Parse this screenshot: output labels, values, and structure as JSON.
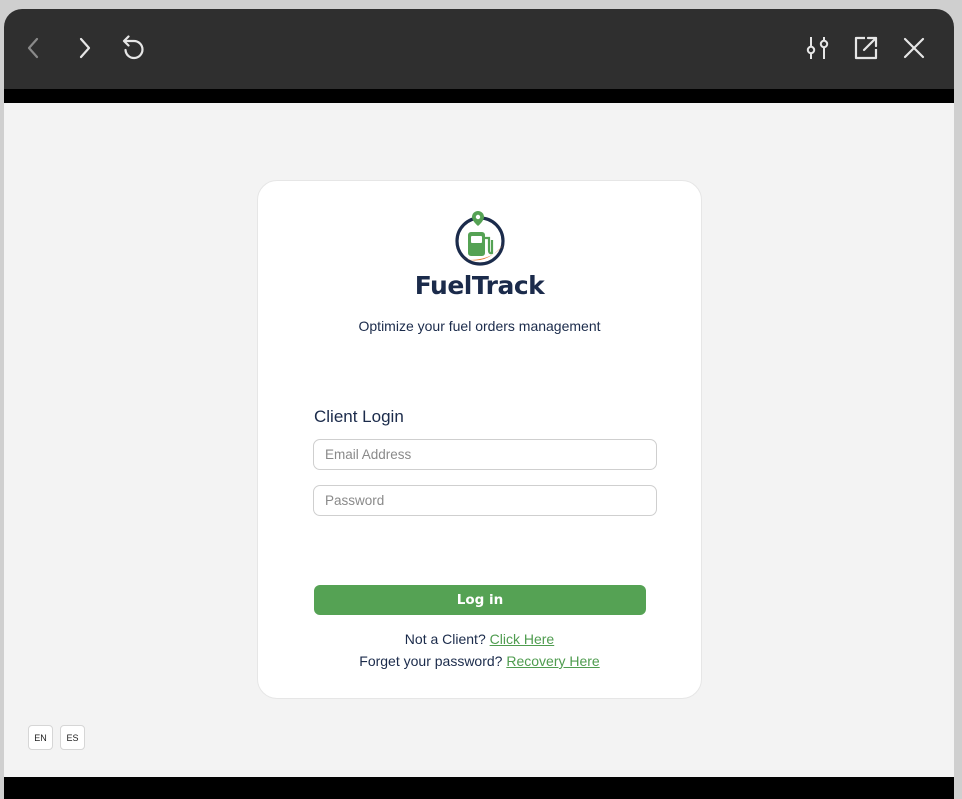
{
  "toolbar": {
    "back_icon": "chevron-left-icon",
    "forward_icon": "chevron-right-icon",
    "reload_icon": "reload-icon",
    "settings_icon": "sliders-icon",
    "open_external_icon": "external-link-icon",
    "close_icon": "close-icon"
  },
  "brand": {
    "name": "FuelTrack",
    "tagline": "Optimize your fuel orders management"
  },
  "login": {
    "title": "Client Login",
    "email_placeholder": "Email Address",
    "password_placeholder": "Password",
    "submit_label": "Log in",
    "not_client_text": "Not a Client?",
    "not_client_link": "Click Here",
    "forgot_text": "Forget your password?",
    "forgot_link": "Recovery Here"
  },
  "languages": [
    "EN",
    "ES"
  ],
  "colors": {
    "accent_green": "#55a254",
    "navy": "#1b2b4b",
    "titlebar": "#2f2f2f",
    "logo_orange": "#e07a2e"
  }
}
